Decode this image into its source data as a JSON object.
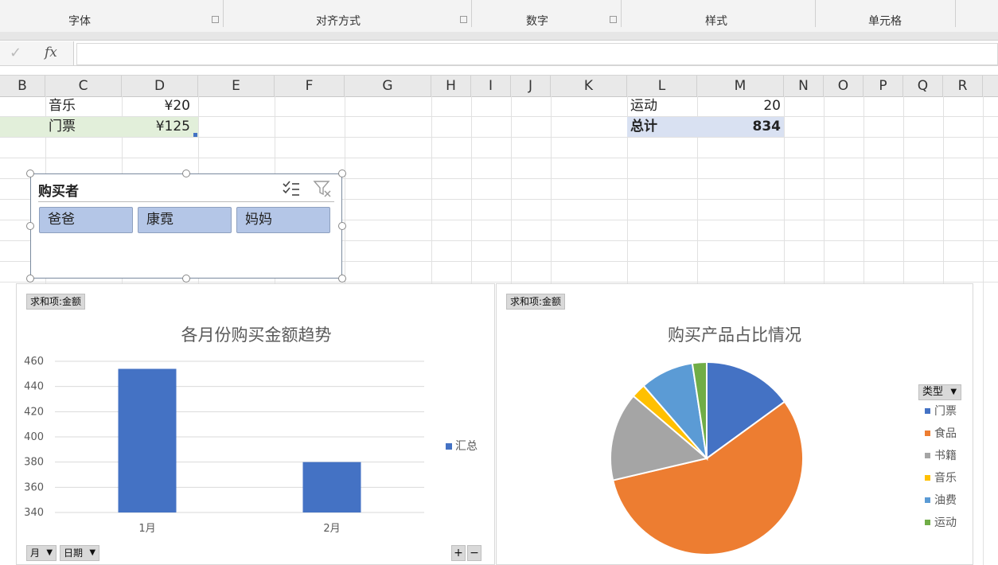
{
  "ribbon": {
    "groups": [
      "字体",
      "对齐方式",
      "数字",
      "样式",
      "单元格"
    ]
  },
  "formula_bar": {
    "fx_label": "fx",
    "check_icon": "check-icon",
    "value": ""
  },
  "columns": [
    "B",
    "C",
    "D",
    "E",
    "F",
    "G",
    "H",
    "I",
    "J",
    "K",
    "L",
    "M",
    "N",
    "O",
    "P",
    "Q",
    "R"
  ],
  "cells": {
    "c1": "音乐",
    "d1": "¥20",
    "c2": "门票",
    "d2": "¥125",
    "l1": "运动",
    "m1": "20",
    "l2": "总计",
    "m2": "834"
  },
  "colors": {
    "selection_fill": "#e2efda",
    "total_fill": "#d9e1f2",
    "slicer_button": "#b4c6e7",
    "series_blue": "#4472c4"
  },
  "slicer": {
    "title": "购买者",
    "items": [
      "爸爸",
      "康霓",
      "妈妈"
    ],
    "multi_select_icon": "multi-select-icon",
    "clear_filter_icon": "clear-filter-icon"
  },
  "bar_chart": {
    "field_button": "求和项:金额",
    "axis_buttons": [
      "月",
      "日期"
    ],
    "expand": "+",
    "collapse": "−",
    "chart_data": {
      "type": "bar",
      "title": "各月份购买金额趋势",
      "categories": [
        "1月",
        "2月"
      ],
      "series": [
        {
          "name": "汇总",
          "values": [
            454,
            380
          ],
          "color": "#4472c4"
        }
      ],
      "ylim": [
        340,
        460
      ],
      "yticks": [
        340,
        360,
        380,
        400,
        420,
        440,
        460
      ],
      "grid": true,
      "legend": "right"
    }
  },
  "pie_chart": {
    "field_button": "求和项:金额",
    "legend_filter": "类型",
    "chart_data": {
      "type": "pie",
      "title": "购买产品占比情况",
      "categories": [
        "门票",
        "食品",
        "书籍",
        "音乐",
        "油费",
        "运动"
      ],
      "values": [
        125,
        470,
        124,
        20,
        75,
        20
      ],
      "colors": [
        "#4472c4",
        "#ed7d31",
        "#a5a5a5",
        "#ffc000",
        "#5b9bd5",
        "#70ad47"
      ],
      "legend": "right"
    }
  }
}
